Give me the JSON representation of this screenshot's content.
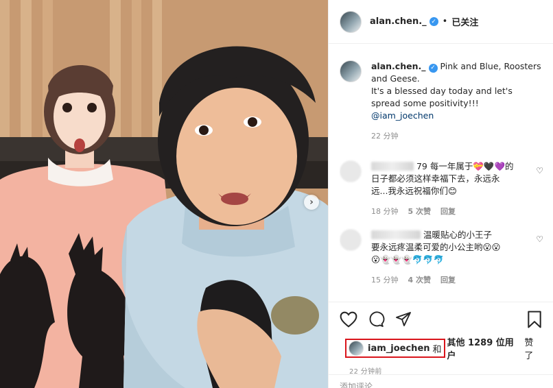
{
  "post": {
    "username": "alan.chen._",
    "follow_state": "已关注",
    "dot": "•",
    "caption": {
      "line1": "Pink and Blue, Roosters",
      "line2": "and Geese.",
      "line3": "It's a blessed day today and let's",
      "line4": "spread some positivity!!!",
      "mention": "@iam_joechen"
    },
    "caption_time": "22 分钟"
  },
  "comments": [
    {
      "text_visible": "79 每一年属于💝🖤💜的",
      "line2": "日子都必须这样幸福下去，永远永",
      "line3": "远...我永远祝福你们😊",
      "time": "18 分钟",
      "likes": "5 次赞",
      "reply": "回复"
    },
    {
      "text_visible": "温暖贴心的小王子",
      "line2": "要永远疼温柔可爱的小公主哟😮😮",
      "line3": "😮👻👻👻🐬🐬🐬",
      "time": "15 分钟",
      "likes": "4 次赞",
      "reply": "回复"
    }
  ],
  "likes": {
    "user": "iam_joechen",
    "conj": "和",
    "others": "其他 1289 位用户",
    "suffix": "赞了"
  },
  "post_time": "22 分钟前",
  "comment_placeholder": "添加评论...",
  "carousel_arrow": "›",
  "colors": {
    "highlight_box": "#d9141b",
    "verified": "#3897f0",
    "mention": "#00376b",
    "meta": "#8e8e8e"
  }
}
